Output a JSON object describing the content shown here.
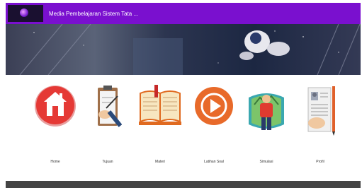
{
  "header": {
    "title": "Media Pembelajaran Sistem Tata ...",
    "logo_icon": "app-logo-icon",
    "color": "#7a10cf"
  },
  "banner": {
    "subject": "astronaut in space"
  },
  "menu": {
    "items": [
      {
        "label": "Home",
        "icon": "home-icon"
      },
      {
        "label": "Tujuan",
        "icon": "clipboard-icon"
      },
      {
        "label": "Materi",
        "icon": "open-book-icon"
      },
      {
        "label": "Latihan Soal",
        "icon": "play-icon"
      },
      {
        "label": "Simulasi",
        "icon": "explorer-icon"
      },
      {
        "label": "Profil",
        "icon": "profile-document-icon"
      }
    ]
  }
}
